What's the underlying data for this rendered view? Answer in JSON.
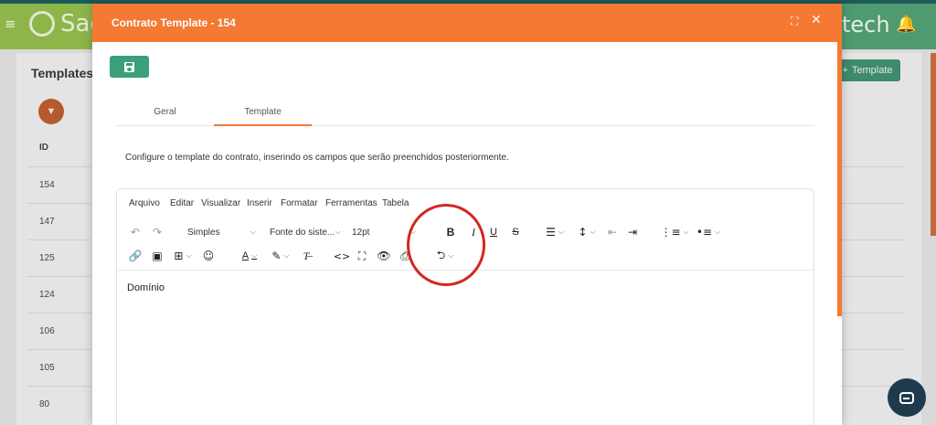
{
  "app": {
    "brand_text": "Sag",
    "brand_tail": "tech",
    "page_title": "Templates",
    "add_template_label": "Template",
    "id_header": "ID",
    "rows": [
      "154",
      "147",
      "125",
      "124",
      "106",
      "105",
      "80"
    ]
  },
  "modal": {
    "title": "Contrato Template - 154",
    "tabs": [
      {
        "label": "Geral"
      },
      {
        "label": "Template"
      }
    ],
    "description": "Configure o template do contrato, inserindo os campos que serão preenchidos posteriormente.",
    "editor": {
      "menu": [
        "Arquivo",
        "Editar",
        "Visualizar",
        "Inserir",
        "Formatar",
        "Ferramentas",
        "Tabela"
      ],
      "block_format": "Simples",
      "font_family": "Fonte do siste...",
      "font_size": "12pt",
      "content": "Domínio"
    }
  },
  "icons": {
    "undo": "undo-icon",
    "redo": "redo-icon",
    "bold": "bold-icon",
    "italic": "italic-icon",
    "underline": "underline-icon",
    "strikethrough": "strikethrough-icon",
    "link": "link-icon",
    "image": "image-icon",
    "table": "table-icon",
    "emoji": "emoji-icon",
    "code": "code-icon",
    "fullscreen": "fullscreen-icon",
    "preview": "eye-icon",
    "print": "print-icon",
    "template": "template-icon"
  },
  "colors": {
    "header": "#f47932",
    "save_button": "#3aa079",
    "annotation": "#d3261f"
  }
}
